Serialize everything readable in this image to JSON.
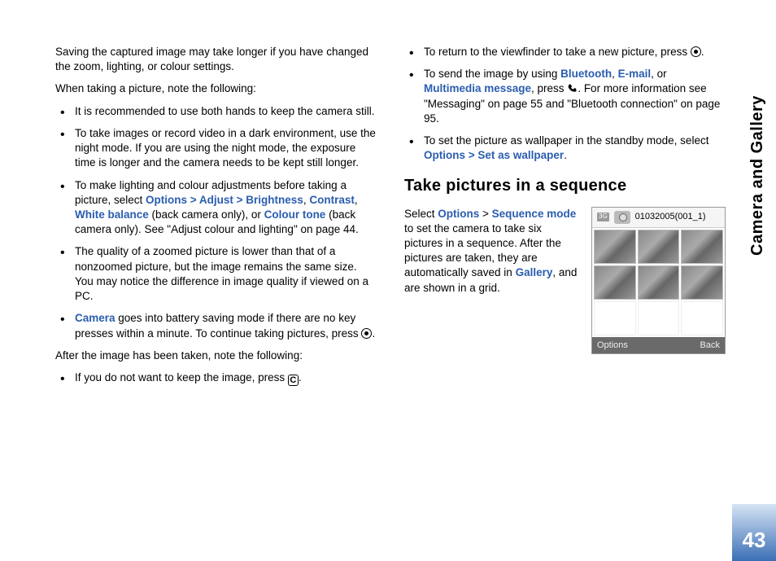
{
  "sidebar": {
    "title": "Camera and Gallery"
  },
  "pageNumber": "43",
  "col1": {
    "p1": "Saving the captured image may take longer if you have changed the zoom, lighting, or colour settings.",
    "p2": "When taking a picture, note the following:",
    "b1": "It is recommended to use both hands to keep the camera still.",
    "b2": "To take images or record video in a dark environment, use the night mode. If you are using the night mode, the exposure time is longer and the camera needs to be kept still longer.",
    "b3_a": "To make lighting and colour adjustments before taking a picture, select ",
    "b3_link1": "Options > Adjust > Brightness",
    "b3_sep1": ", ",
    "b3_link2": "Contrast",
    "b3_sep2": ", ",
    "b3_link3": "White balance",
    "b3_mid": " (back camera only), or ",
    "b3_link4": "Colour tone",
    "b3_end": " (back camera only). See \"Adjust colour and lighting\" on page 44.",
    "b4": "The quality of a zoomed picture is lower than that of a nonzoomed picture, but the image remains the same size. You may notice the difference in image quality if viewed on a PC.",
    "b5_link": "Camera",
    "b5_text": " goes into battery saving mode if there are no key presses within a minute. To continue taking pictures, press ",
    "b5_end": ".",
    "p3": "After the image has been taken, note the following:",
    "b6_a": "If you do not want to keep the image, press ",
    "b6_icon_text": "C",
    "b6_end": "."
  },
  "col2": {
    "b1_a": "To return to the viewfinder to take a new picture, press ",
    "b1_end": ".",
    "b2_a": "To send the image by using ",
    "b2_link1": "Bluetooth",
    "b2_sep1": ", ",
    "b2_link2": "E-mail",
    "b2_sep2": ", or ",
    "b2_link3": "Multimedia message",
    "b2_mid": ", press ",
    "b2_end": ". For more information see \"Messaging\" on page 55 and \"Bluetooth connection\" on page 95.",
    "b3_a": "To set the picture as wallpaper in the standby mode, select ",
    "b3_link": "Options > Set as wallpaper",
    "b3_end": ".",
    "h2": "Take pictures in a sequence",
    "seq_a": "Select ",
    "seq_link1": "Options",
    "seq_sep": " > ",
    "seq_link2": "Sequence mode",
    "seq_mid": " to set the camera to take six pictures in a sequence. After the pictures are taken, they are automatically saved in ",
    "seq_link3": "Gallery",
    "seq_end": ", and are shown in a grid."
  },
  "phone": {
    "sig": "3G",
    "filename": "01032005(001_1)",
    "left": "Options",
    "right": "Back"
  }
}
